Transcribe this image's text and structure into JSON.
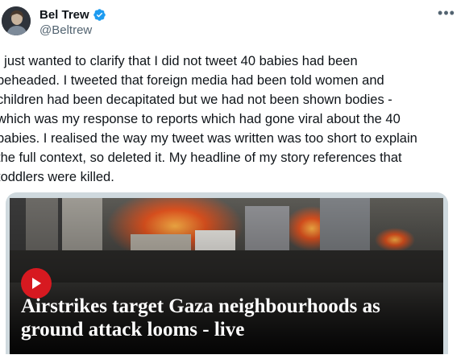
{
  "author": {
    "display_name": "Bel Trew",
    "handle": "@Beltrew",
    "verified": true
  },
  "tweet": {
    "text": "I just wanted to clarify that I did not tweet 40 babies had been\nbeheaded. I tweeted that foreign media had been told women and\nchildren had been decapitated but we had not been shown bodies -\nwhich was my response to reports which had gone viral about the 40\nbabies. I realised the way my tweet was written was too short to explain\nthe full context, so deleted it. My headline of my story references that\ntoddlers were killed."
  },
  "card": {
    "headline": "Airstrikes target Gaza neighbourhoods as ground attack looms - live"
  },
  "colors": {
    "verified_blue": "#1d9bf0",
    "text_primary": "#0f1419",
    "text_secondary": "#536471",
    "play_red": "#d71920"
  },
  "icons": {
    "verified": "verified-badge-icon",
    "more": "more-options-icon",
    "play": "play-icon"
  }
}
